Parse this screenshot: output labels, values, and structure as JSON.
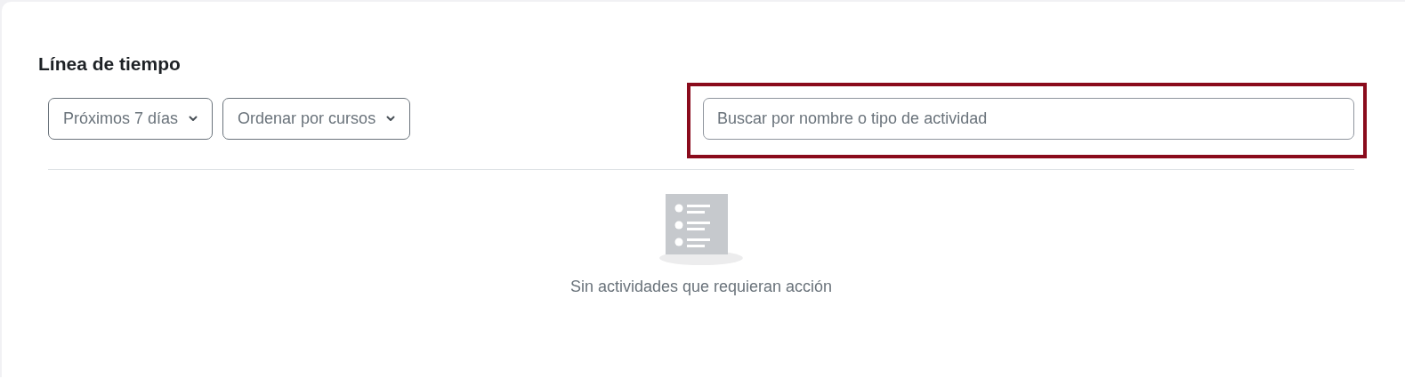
{
  "title": "Línea de tiempo",
  "filters": [
    {
      "label": "Próximos 7 días"
    },
    {
      "label": "Ordenar por cursos"
    }
  ],
  "search": {
    "placeholder": "Buscar por nombre o tipo de actividad",
    "highlighted": true
  },
  "empty_state": {
    "message": "Sin actividades que requieran acción"
  }
}
